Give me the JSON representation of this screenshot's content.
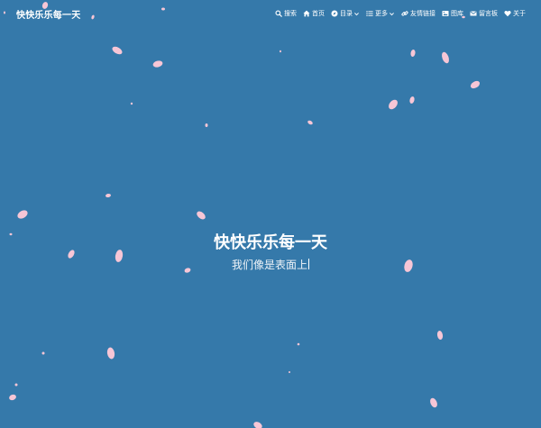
{
  "site": {
    "brand": "快快乐乐每一天"
  },
  "nav": {
    "items": [
      {
        "label": "搜索",
        "icon": "search-icon"
      },
      {
        "label": "首页",
        "icon": "home-icon"
      },
      {
        "label": "目录",
        "icon": "compass-icon",
        "dropdown": true
      },
      {
        "label": "更多",
        "icon": "list-icon",
        "dropdown": true
      },
      {
        "label": "友情链接",
        "icon": "link-icon"
      },
      {
        "label": "图库",
        "icon": "image-icon"
      },
      {
        "label": "留言板",
        "icon": "envelope-icon"
      },
      {
        "label": "关于",
        "icon": "heart-icon"
      }
    ]
  },
  "hero": {
    "title": "快快乐乐每一天",
    "subtitle": "我们像是表面上"
  },
  "colors": {
    "background": "#3579aa",
    "petal": "#f7c6d6",
    "text": "#ffffff"
  }
}
